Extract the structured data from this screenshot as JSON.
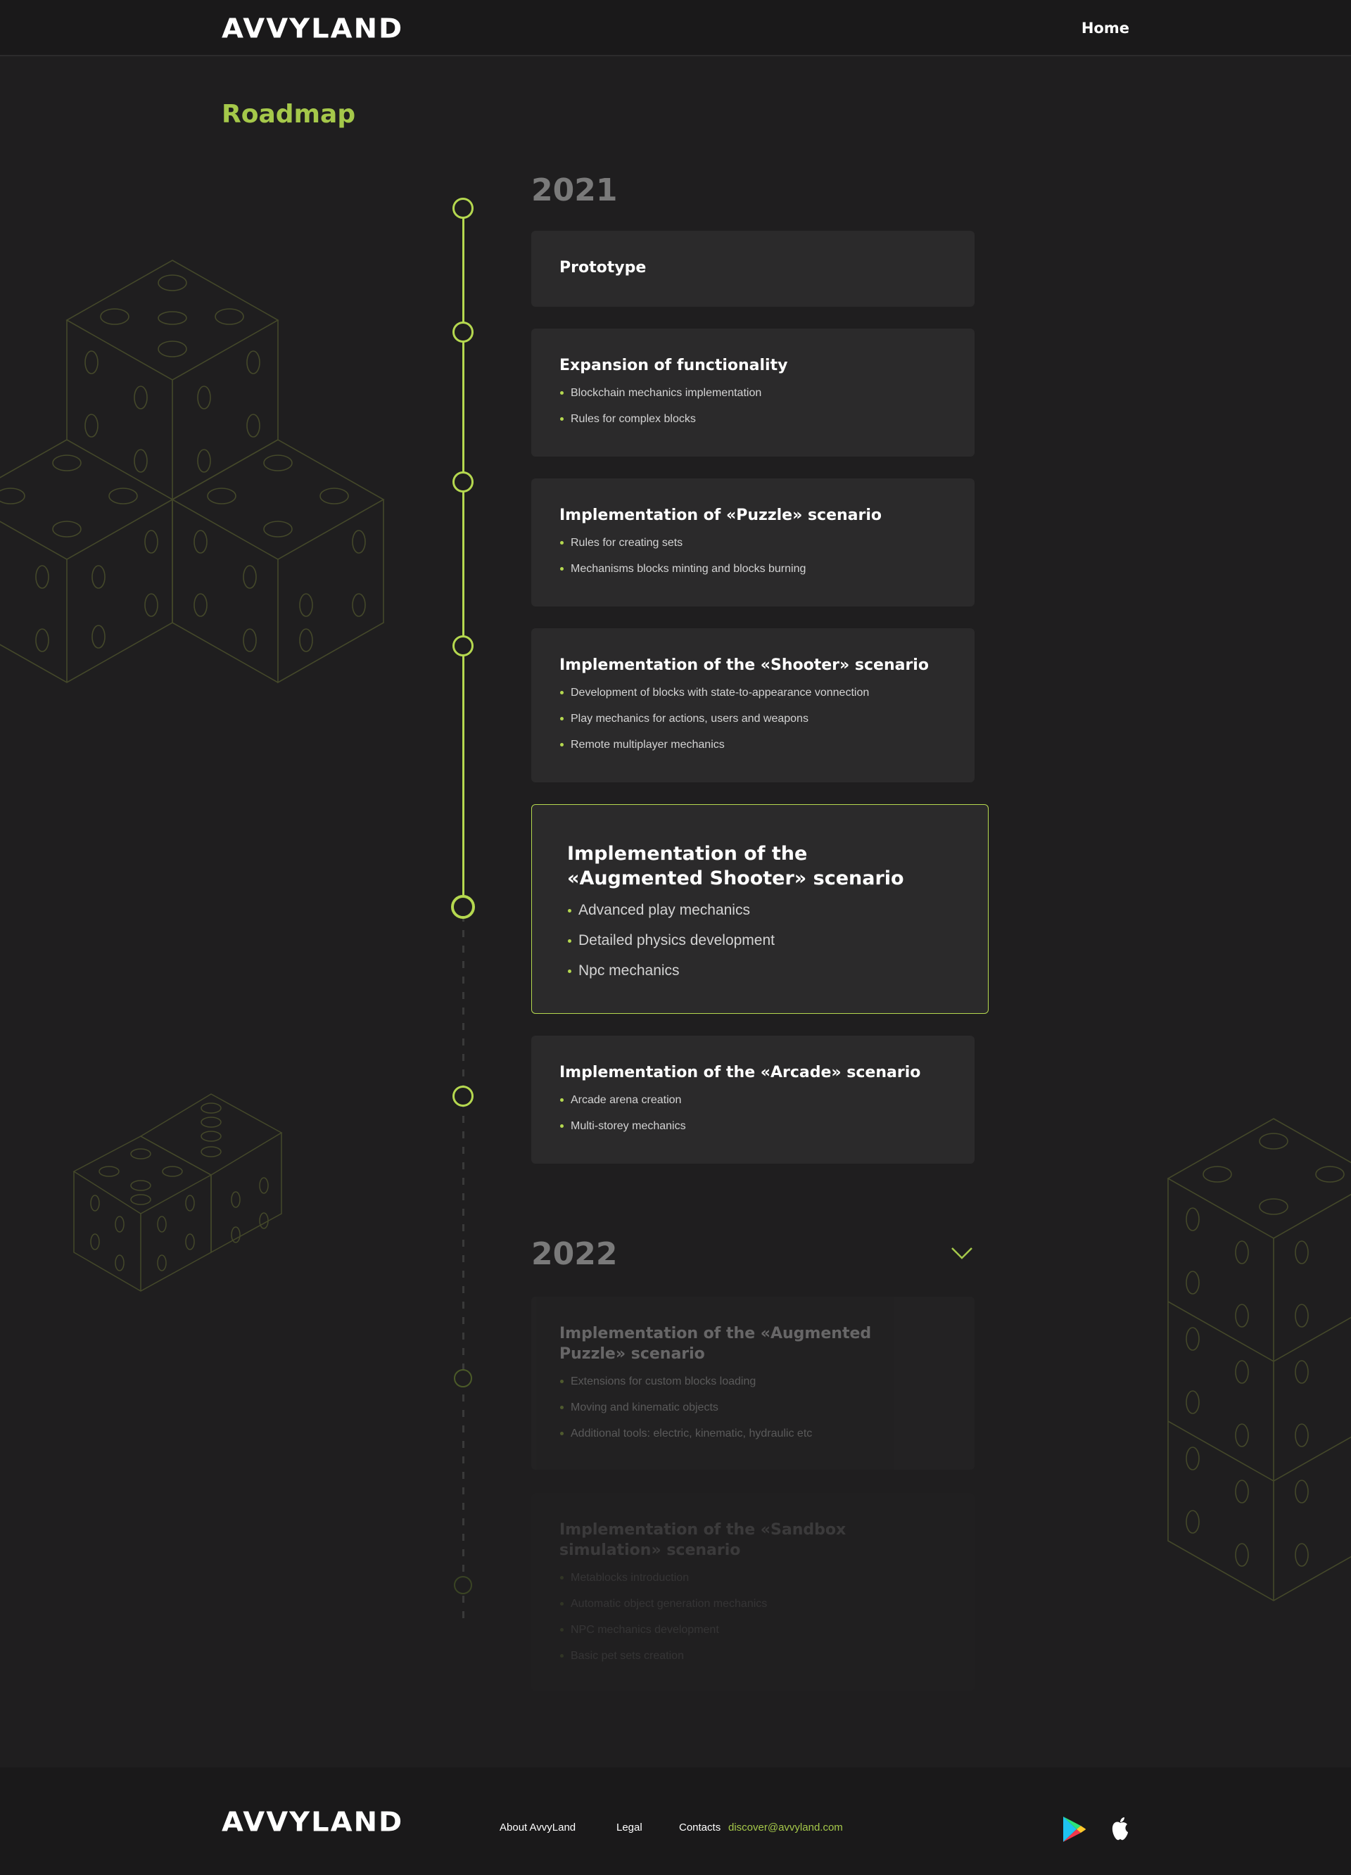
{
  "header": {
    "logo": "AVVYLAND",
    "nav_home": "Home"
  },
  "page": {
    "title": "Roadmap"
  },
  "years": [
    "2021",
    "2022"
  ],
  "cards": [
    {
      "title": "Prototype",
      "items": []
    },
    {
      "title": "Expansion of functionality",
      "items": [
        "Blockchain mechanics implementation",
        "Rules for complex blocks"
      ]
    },
    {
      "title": "Implementation of  «Puzzle» scenario",
      "items": [
        "Rules for creating sets",
        "Mechanisms blocks minting and blocks burning"
      ]
    },
    {
      "title": "Implementation of the «Shooter» scenario",
      "items": [
        "Development of blocks with state-to-appearance vonnection",
        "Play mechanics for actions, users and weapons",
        "Remote multiplayer mechanics"
      ]
    },
    {
      "title": "Implementation of the «Augmented Shooter» scenario",
      "items": [
        "Advanced play mechanics",
        "Detailed physics development",
        "Npc mechanics"
      ]
    },
    {
      "title": "Implementation of the «Arcade» scenario",
      "items": [
        "Arcade arena creation",
        "Multi-storey mechanics"
      ]
    },
    {
      "title": "Implementation of the «Augmented Puzzle» scenario",
      "items": [
        "Extensions for custom blocks loading",
        "Moving and kinematic objects",
        "Additional tools: electric, kinematic, hydraulic etc"
      ]
    },
    {
      "title": "Implementation of the «Sandbox simulation» scenario",
      "items": [
        "Metablocks introduction",
        "Automatic object generation mechanics",
        "NPC mechanics development",
        "Basic pet sets creation"
      ]
    }
  ],
  "footer": {
    "logo": "AVVYLAND",
    "about": "About AvvyLand",
    "legal": "Legal",
    "contacts_label": "Contacts",
    "email": "discover@avvyland.com"
  },
  "colors": {
    "accent": "#b5d84f",
    "title_green": "#a5c84a",
    "bg": "#1f1e1f",
    "card": "#2b2a2b"
  },
  "icons": [
    "chevron-down-icon",
    "google-play-icon",
    "apple-icon"
  ]
}
